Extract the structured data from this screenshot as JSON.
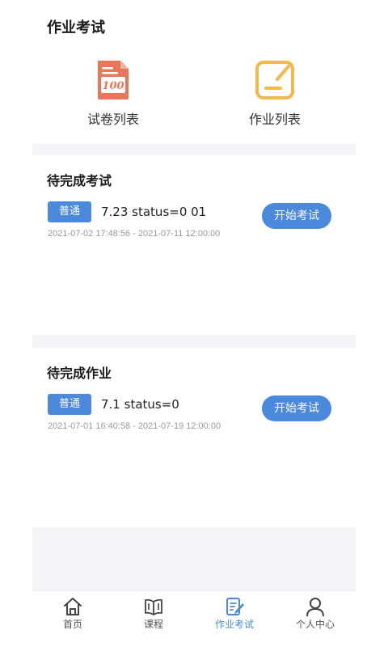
{
  "header": {
    "title": "作业考试"
  },
  "entries": [
    {
      "label": "试卷列表",
      "icon": "exam-paper-icon",
      "color": "#e8775a"
    },
    {
      "label": "作业列表",
      "icon": "homework-icon",
      "color": "#f3b84a"
    }
  ],
  "exam_section": {
    "title": "待完成考试",
    "item": {
      "tag": "普通",
      "name": "7.23 status=0 01",
      "time": "2021-07-02 17:48:56 - 2021-07-11 12:00:00",
      "button": "开始考试"
    }
  },
  "homework_section": {
    "title": "待完成作业",
    "item": {
      "tag": "普通",
      "name": "7.1 status=0",
      "time": "2021-07-01 16:40:58 - 2021-07-19 12:00:00",
      "button": "开始考试"
    }
  },
  "nav": {
    "items": [
      {
        "label": "首页",
        "icon": "home-icon"
      },
      {
        "label": "课程",
        "icon": "book-icon"
      },
      {
        "label": "作业考试",
        "icon": "homework-exam-icon",
        "active": true
      },
      {
        "label": "个人中心",
        "icon": "person-icon"
      }
    ],
    "active_color": "#4a89dc"
  },
  "colors": {
    "accent": "#4a89dc",
    "background": "#f3f5f9"
  }
}
